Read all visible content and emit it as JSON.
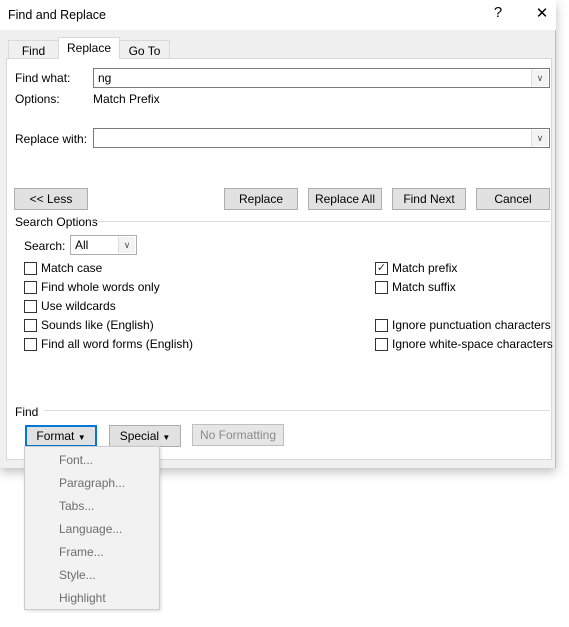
{
  "title": "Find and Replace",
  "help_label": "?",
  "close_label": "✕",
  "tabs": [
    {
      "label": "Find",
      "selected": false
    },
    {
      "label": "Replace",
      "selected": true
    },
    {
      "label": "Go To",
      "selected": false
    }
  ],
  "find_what": {
    "label": "Find what:",
    "value": "ng"
  },
  "options": {
    "label": "Options:",
    "value": "Match Prefix"
  },
  "replace_with": {
    "label": "Replace with:",
    "value": ""
  },
  "buttons": {
    "less": "<< Less",
    "replace": "Replace",
    "replace_all": "Replace All",
    "find_next": "Find Next",
    "cancel": "Cancel"
  },
  "search_options": {
    "heading": "Search Options",
    "search_label": "Search:",
    "search_value": "All"
  },
  "checkboxes": [
    {
      "label": "Match case",
      "checked": false
    },
    {
      "label": "Find whole words only",
      "checked": false
    },
    {
      "label": "Use wildcards",
      "checked": false
    },
    {
      "label": "Sounds like (English)",
      "checked": false
    },
    {
      "label": "Find all word forms (English)",
      "checked": false
    },
    {
      "label": "Match prefix",
      "checked": true
    },
    {
      "label": "Match suffix",
      "checked": false
    },
    {
      "label": "Ignore punctuation characters",
      "checked": false
    },
    {
      "label": "Ignore white-space characters",
      "checked": false
    }
  ],
  "find_section": {
    "heading": "Find",
    "format": "Format",
    "special": "Special",
    "no_formatting": "No Formatting"
  },
  "format_menu": [
    "Font...",
    "Paragraph...",
    "Tabs...",
    "Language...",
    "Frame...",
    "Style...",
    "Highlight"
  ],
  "colors": {
    "accent": "#0078d7",
    "dialog_bg": "#f0f0f0"
  }
}
